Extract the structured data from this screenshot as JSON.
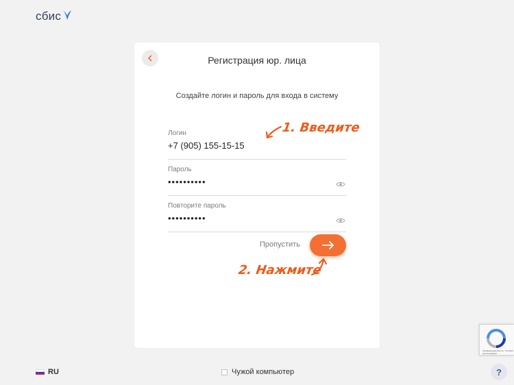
{
  "brand": {
    "logo_text": "сбис",
    "accent_color": "#2d7bd6"
  },
  "card": {
    "title": "Регистрация юр. лица",
    "subtitle": "Создайте логин и пароль для входа в систему",
    "fields": [
      {
        "label": "Логин",
        "value": "+7 (905) 155-15-15",
        "type": "text"
      },
      {
        "label": "Пароль",
        "value": "••••••••••",
        "type": "password",
        "icon": "eye-icon"
      },
      {
        "label": "Повторите пароль",
        "value": "••••••••••",
        "type": "password",
        "icon": "eye-icon"
      }
    ],
    "skip_label": "Пропустить",
    "next_icon": "arrow-right-icon",
    "accent_color": "#f36f33"
  },
  "annotations": {
    "step1": "1. Введите",
    "step2": "2. Нажмите",
    "color": "#f05a1a"
  },
  "footer": {
    "language": "RU",
    "foreign_computer_label": "Чужой компьютер",
    "help_label": "?"
  },
  "recaptcha": {
    "text": "Конфиденциальность - Условия использования"
  }
}
